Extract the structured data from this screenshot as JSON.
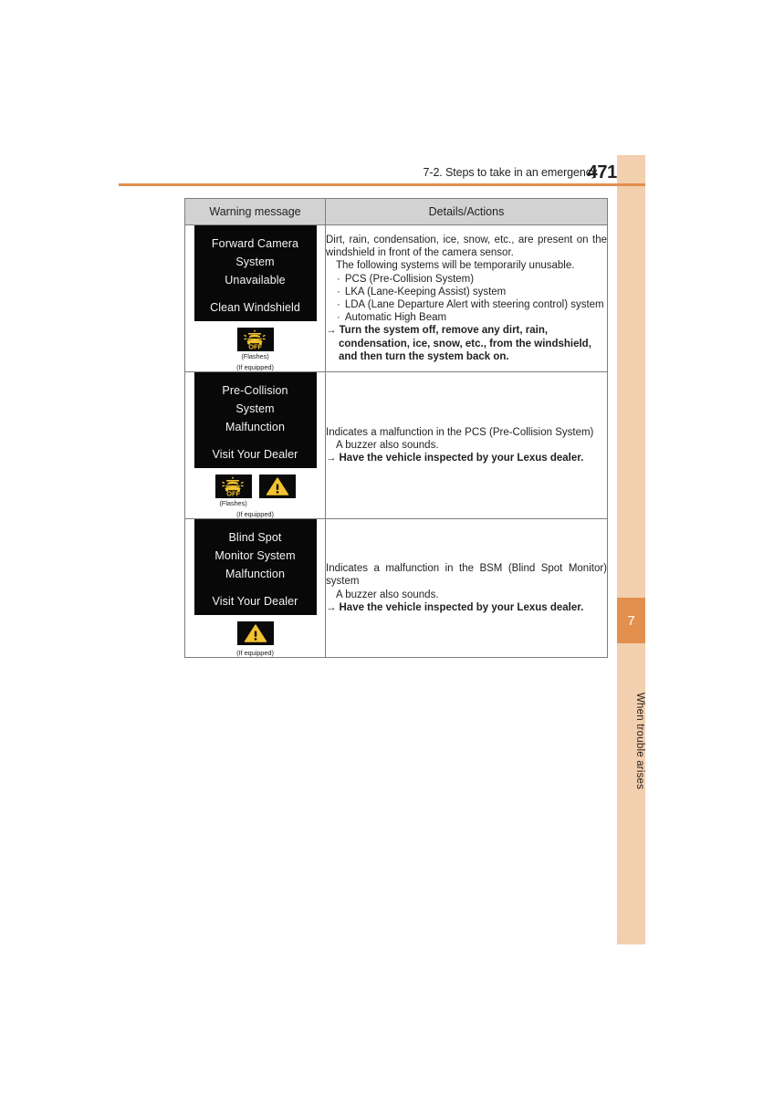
{
  "page": {
    "header_title": "7-2. Steps to take in an emergency",
    "page_number": "471"
  },
  "chapter_tab": {
    "number": "7",
    "label": "When trouble arises",
    "strip_color": "#f2cfae",
    "number_box_color": "#e3904f",
    "rule_color": "#e08f4f"
  },
  "table": {
    "headers": {
      "warning_message": "Warning message",
      "details_actions": "Details/Actions"
    },
    "rows": [
      {
        "display": {
          "lines": [
            "Forward Camera",
            "System",
            "Unavailable"
          ],
          "bottom_line": "Clean Windshield"
        },
        "icons": [
          {
            "name": "pcs-off-icon",
            "caption": "(Flashes)"
          }
        ],
        "if_equipped": "(If equipped)",
        "details": {
          "intro": "Dirt, rain, condensation, ice, snow, etc., are present on the windshield in front of the camera sensor.",
          "sub": "The following systems will be temporarily unusable.",
          "bullets": [
            "PCS (Pre-Collision System)",
            "LKA (Lane-Keeping Assist) system",
            "LDA (Lane Departure Alert with steering control) system",
            "Automatic High Beam"
          ],
          "action": "Turn the system off, remove any dirt, rain, condensation, ice, snow, etc., from the windshield, and then turn the system back on."
        }
      },
      {
        "display": {
          "lines": [
            "Pre-Collision",
            "System",
            "Malfunction"
          ],
          "bottom_line": "Visit Your Dealer"
        },
        "icons": [
          {
            "name": "pcs-off-icon",
            "caption": "(Flashes)"
          },
          {
            "name": "warning-triangle-icon",
            "caption": ""
          }
        ],
        "if_equipped": "(If equipped)",
        "details": {
          "intro": "Indicates a malfunction in the PCS (Pre-Collision System)",
          "sub": "A buzzer also sounds.",
          "bullets": [],
          "action": "Have the vehicle inspected by your Lexus dealer."
        }
      },
      {
        "display": {
          "lines": [
            "Blind Spot",
            "Monitor System",
            "Malfunction"
          ],
          "bottom_line": "Visit Your Dealer"
        },
        "icons": [
          {
            "name": "warning-triangle-icon",
            "caption": ""
          }
        ],
        "if_equipped": "(If equipped)",
        "details": {
          "intro": "Indicates a malfunction in the BSM (Blind Spot Monitor) system",
          "sub": "A buzzer also sounds.",
          "bullets": [],
          "action": "Have the vehicle inspected by your Lexus dealer."
        }
      }
    ],
    "bullet_glyph": "·",
    "arrow_glyph": "→"
  }
}
